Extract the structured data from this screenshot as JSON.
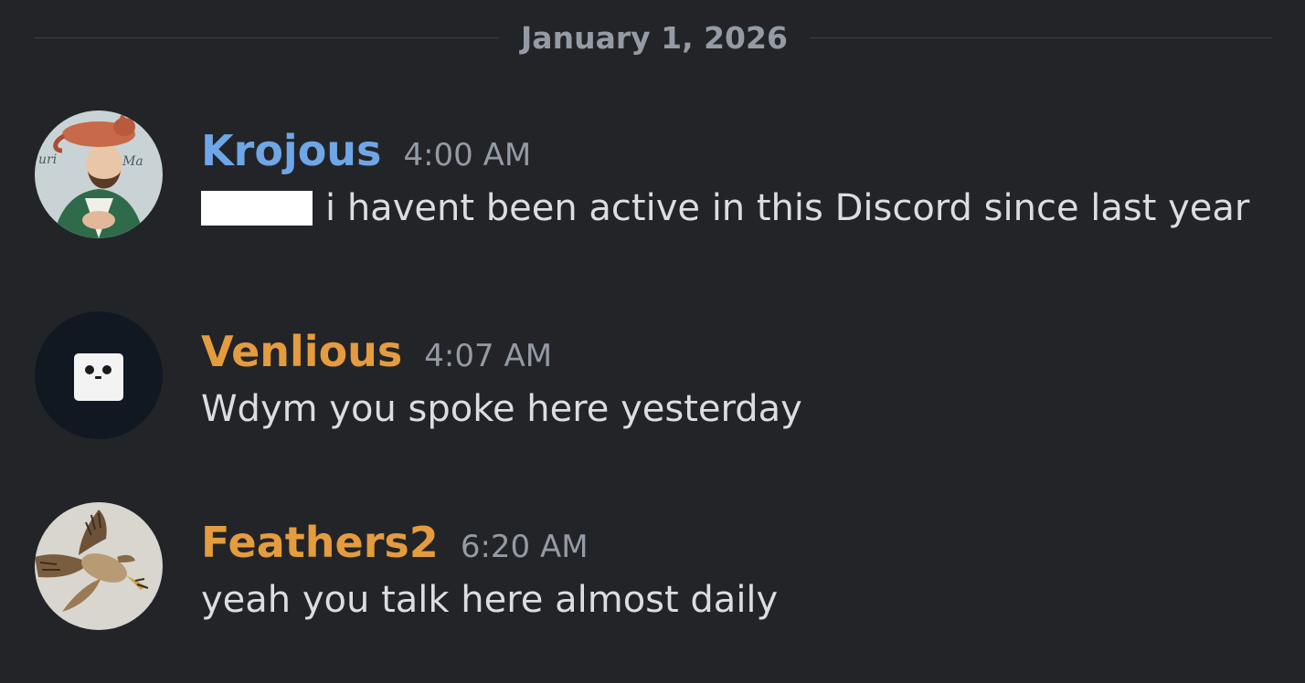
{
  "divider": {
    "date": "January 1, 2026"
  },
  "colors": {
    "background": "#232428",
    "text": "#dbdee1",
    "muted": "#949ba4",
    "username_blue": "#6fa6e6",
    "username_orange": "#e49c3f"
  },
  "messages": [
    {
      "username": "Krojous",
      "timestamp": "4:00 AM",
      "text": "i havent been active in this Discord since last year",
      "avatar_icon": "saint-statue-with-cat-avatar",
      "name_color": "#6fa6e6",
      "has_redacted_mention": true
    },
    {
      "username": "Venlious",
      "timestamp": "4:07 AM",
      "text": "Wdym you spoke here yesterday",
      "avatar_icon": "white-cube-face-avatar",
      "name_color": "#e49c3f",
      "has_redacted_mention": false
    },
    {
      "username": "Feathers2",
      "timestamp": "6:20 AM",
      "text": "yeah you talk here almost daily",
      "avatar_icon": "hawk-in-flight-avatar",
      "name_color": "#e49c3f",
      "has_redacted_mention": false
    }
  ]
}
